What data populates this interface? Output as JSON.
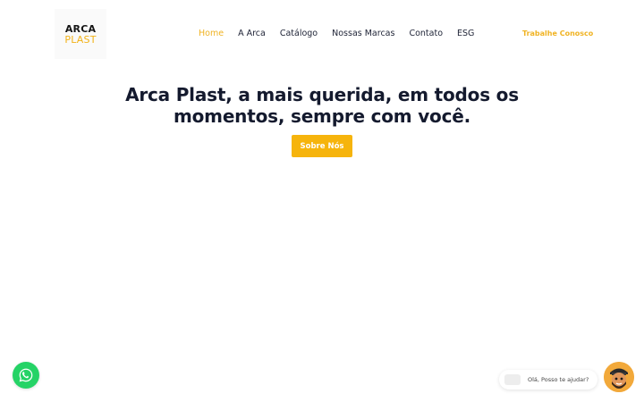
{
  "logo": {
    "line1": "ARCA",
    "line2": "PLAST"
  },
  "nav": {
    "items": [
      {
        "label": "Home",
        "active": true
      },
      {
        "label": "A Arca",
        "active": false
      },
      {
        "label": "Catálogo",
        "active": false
      },
      {
        "label": "Nossas Marcas",
        "active": false
      },
      {
        "label": "Contato",
        "active": false
      },
      {
        "label": "ESG",
        "active": false
      }
    ],
    "trabalhe_label": "Trabalhe Conosco"
  },
  "hero": {
    "title_line1": "Arca Plast, a mais querida, em todos os",
    "title_line2": "momentos, sempre com você.",
    "cta_label": "Sobre Nós"
  },
  "chat": {
    "message": "Olá, Posso te ajudar?"
  },
  "icons": {
    "whatsapp": "whatsapp-icon",
    "avatar": "assistant-avatar-icon"
  },
  "colors": {
    "accent": "#f0b323",
    "cta_bg": "#f6b40c",
    "heading": "#141a2e",
    "whatsapp": "#25d366"
  }
}
